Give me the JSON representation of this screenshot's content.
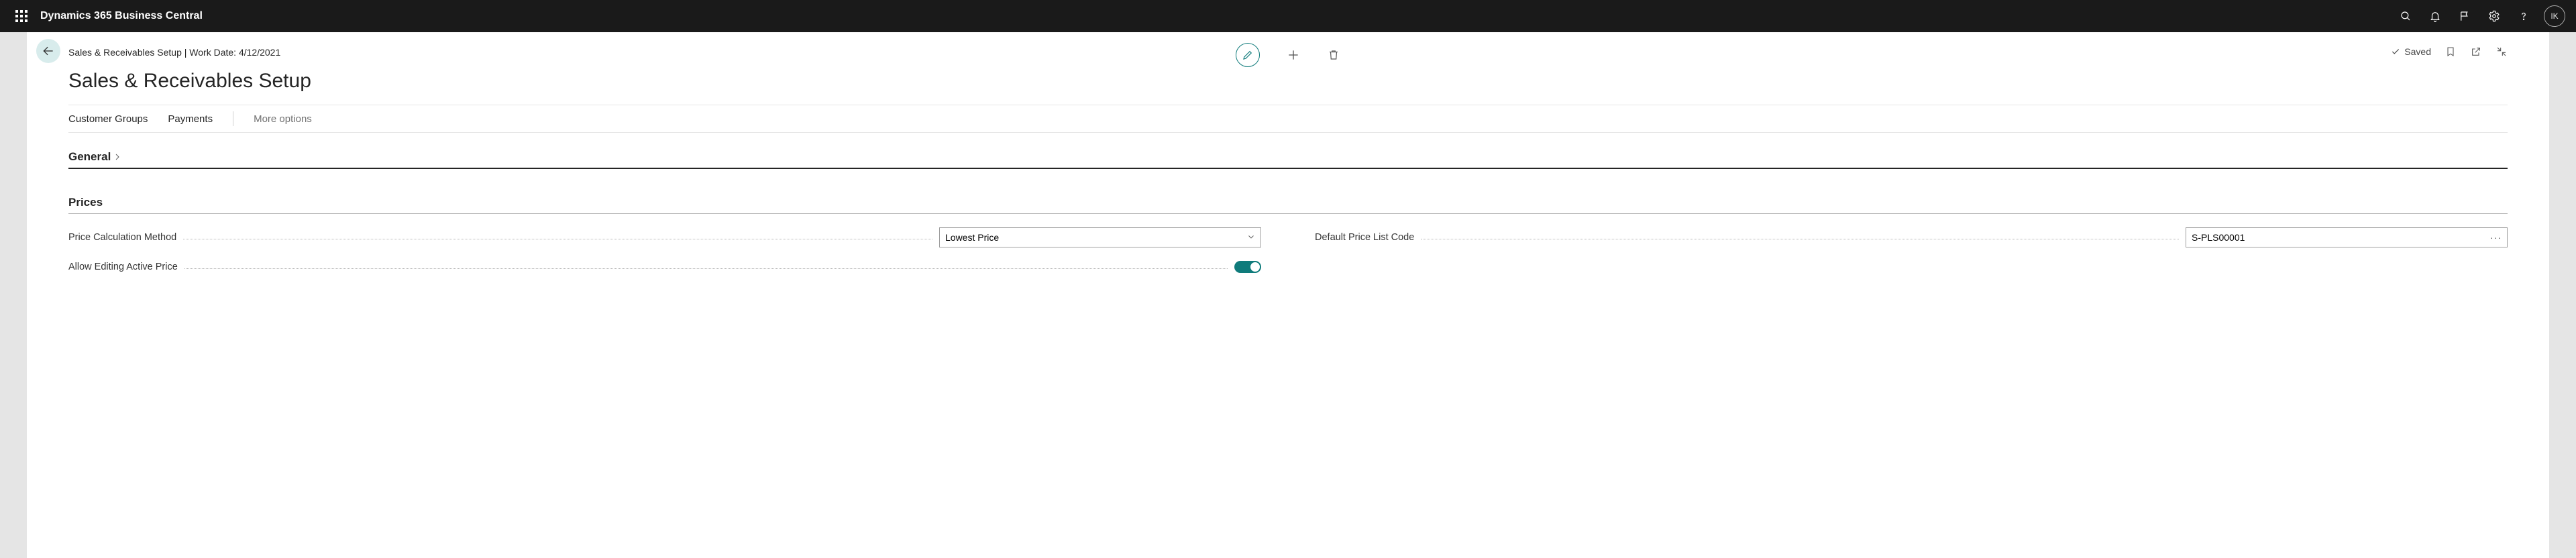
{
  "brand": "Dynamics 365 Business Central",
  "user_initials": "IK",
  "breadcrumb": "Sales & Receivables Setup | Work Date: 4/12/2021",
  "saved_label": "Saved",
  "page_title": "Sales & Receivables Setup",
  "action_bar": {
    "item1": "Customer Groups",
    "item2": "Payments",
    "more": "More options"
  },
  "sections": {
    "general": "General",
    "prices": "Prices"
  },
  "fields": {
    "price_calc": {
      "label": "Price Calculation Method",
      "value": "Lowest Price"
    },
    "default_price_list": {
      "label": "Default Price List Code",
      "value": "S-PLS00001"
    },
    "allow_editing": {
      "label": "Allow Editing Active Price"
    }
  }
}
